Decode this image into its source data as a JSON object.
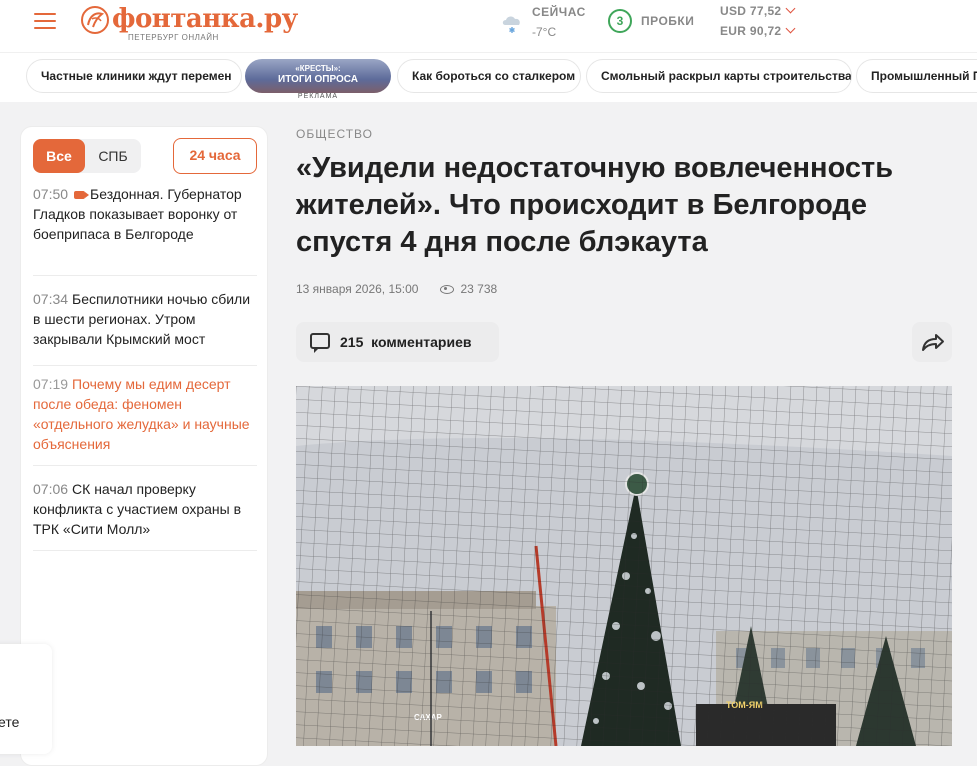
{
  "header": {
    "logo_text": "фонтанка.ру",
    "logo_sub": "ПЕТЕРБУРГ ОНЛАЙН",
    "weather": {
      "label": "СЕЙЧАС",
      "temp": "-7°C"
    },
    "traffic": {
      "score": "3",
      "label": "ПРОБКИ"
    },
    "rates": [
      {
        "text": "USD 77,52"
      },
      {
        "text": "EUR 90,72"
      }
    ]
  },
  "chips": [
    "Частные клиники ждут перемен",
    "Как бороться со сталкером",
    "Смольный раскрыл карты строительства",
    "Промышленный Пе"
  ],
  "promo": {
    "top": "«КРЕСТЫ»:",
    "main": "ИТОГИ ОПРОСА",
    "ad_label": "РЕКЛАМА"
  },
  "sidebar": {
    "tab_all": "Все",
    "tab_spb": "СПБ",
    "tab_24h": "24 часа",
    "news": [
      {
        "time": "07:50",
        "text": "Бездонная. Губернатор Гладков показывает воронку от боеприпаса в Белгороде",
        "video": true
      },
      {
        "time": "07:34",
        "text": "Беспилотники ночью сбили в шести регионах. Утром закрывали Крымский мост"
      },
      {
        "time": "07:19",
        "text": "Почему мы едим десерт после обеда: феномен «отдельного желудка» и научные объяснения",
        "accent": true
      },
      {
        "time": "07:06",
        "text": "СК начал проверку конфликта с участием охраны в ТРК «Сити Молл»"
      }
    ]
  },
  "article": {
    "rubric": "ОБЩЕСТВО",
    "title": "«Увидели недостаточную вовлеченность жителей». Что происходит в Белгороде спустя 4 дня после блэкаута",
    "date": "13 января 2026, 15:00",
    "views": "23 738",
    "comments_count": "215",
    "comments_label": "комментариев",
    "photo_signs": {
      "clock_like": "",
      "sign1": "ТОМ-ЯМ",
      "sign2": "САХАР"
    }
  },
  "left_edge_text": "ете",
  "colors": {
    "accent": "#e4683a",
    "traffic_green": "#3fa65a",
    "rate_arrow": "#e0533f"
  }
}
